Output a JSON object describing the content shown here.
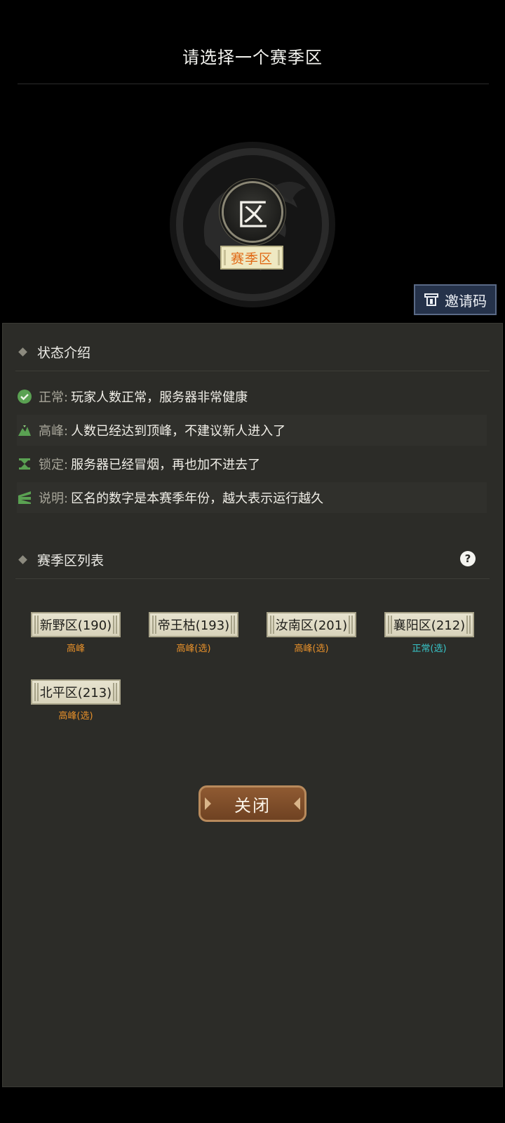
{
  "header": {
    "title": "请选择一个赛季区"
  },
  "emblem": {
    "badge_glyph": "区",
    "tag_label": "赛季区"
  },
  "invite_button": {
    "label": "邀请码",
    "icon": "invite-icon"
  },
  "status_intro": {
    "title": "状态介绍",
    "items": [
      {
        "label": "正常:",
        "text": "玩家人数正常，服务器非常健康",
        "icon": "check-circle-icon"
      },
      {
        "label": "高峰:",
        "text": "人数已经达到顶峰，不建议新人进入了",
        "icon": "peak-icon"
      },
      {
        "label": "锁定:",
        "text": "服务器已经冒烟，再也加不进去了",
        "icon": "lock-icon"
      },
      {
        "label": "说明:",
        "text": "区名的数字是本赛季年份，越大表示运行越久",
        "icon": "info-icon"
      }
    ]
  },
  "server_list": {
    "title": "赛季区列表",
    "help_glyph": "?",
    "servers": [
      {
        "name": "新野区(190)",
        "status": "高峰",
        "status_color": "#e8912a"
      },
      {
        "name": "帝王枯(193)",
        "status": "高峰(选)",
        "status_color": "#e8912a"
      },
      {
        "name": "汝南区(201)",
        "status": "高峰(选)",
        "status_color": "#e8912a"
      },
      {
        "name": "襄阳区(212)",
        "status": "正常(选)",
        "status_color": "#38c6c9"
      },
      {
        "name": "北平区(213)",
        "status": "高峰(选)",
        "status_color": "#e8912a"
      }
    ]
  },
  "close_button": {
    "label": "关闭"
  }
}
